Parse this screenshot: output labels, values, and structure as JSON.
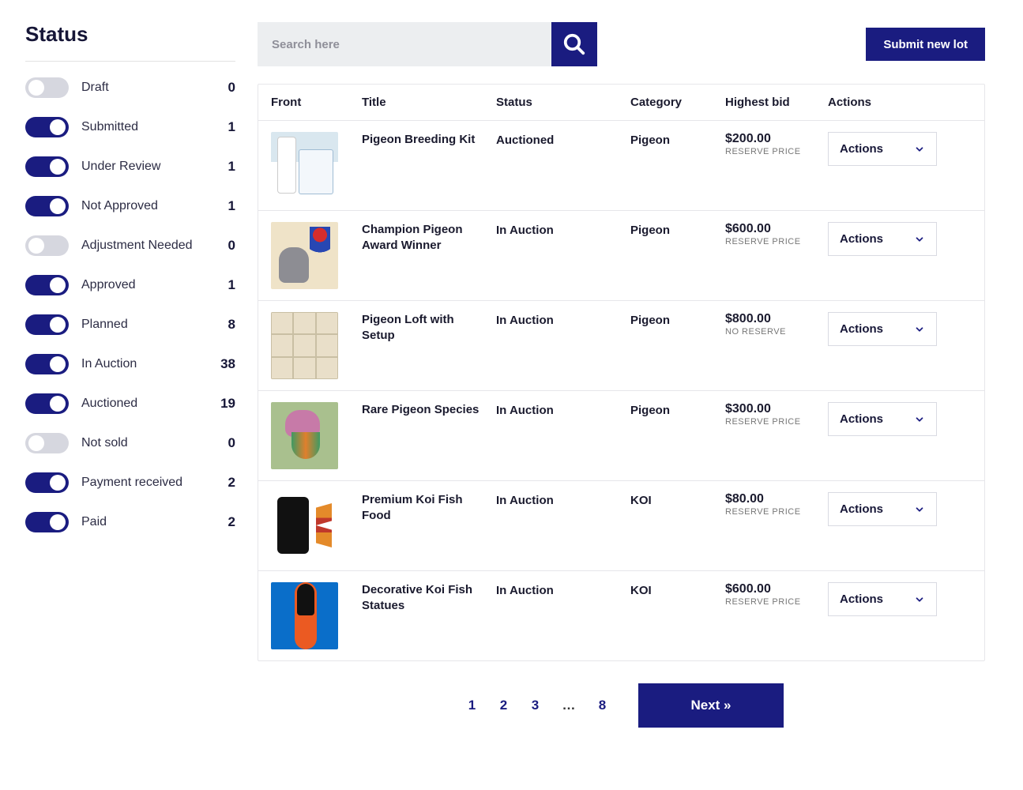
{
  "sidebar": {
    "title": "Status",
    "filters": [
      {
        "label": "Draft",
        "count": 0,
        "on": false
      },
      {
        "label": "Submitted",
        "count": 1,
        "on": true
      },
      {
        "label": "Under Review",
        "count": 1,
        "on": true
      },
      {
        "label": "Not Approved",
        "count": 1,
        "on": true
      },
      {
        "label": "Adjustment Needed",
        "count": 0,
        "on": false
      },
      {
        "label": "Approved",
        "count": 1,
        "on": true
      },
      {
        "label": "Planned",
        "count": 8,
        "on": true
      },
      {
        "label": "In Auction",
        "count": 38,
        "on": true
      },
      {
        "label": "Auctioned",
        "count": 19,
        "on": true
      },
      {
        "label": "Not sold",
        "count": 0,
        "on": false
      },
      {
        "label": "Payment received",
        "count": 2,
        "on": true
      },
      {
        "label": "Paid",
        "count": 2,
        "on": true
      }
    ]
  },
  "topbar": {
    "search_placeholder": "Search here",
    "search_value": "",
    "submit_label": "Submit new lot"
  },
  "table": {
    "headers": {
      "front": "Front",
      "title": "Title",
      "status": "Status",
      "category": "Category",
      "highest_bid": "Highest bid",
      "actions": "Actions"
    },
    "actions_button_label": "Actions",
    "rows": [
      {
        "title": "Pigeon Breeding Kit",
        "status": "Auctioned",
        "category": "Pigeon",
        "bid": "$200.00",
        "reserve": "RESERVE PRICE",
        "thumb": "a"
      },
      {
        "title": "Champion Pigeon Award Winner",
        "status": "In Auction",
        "category": "Pigeon",
        "bid": "$600.00",
        "reserve": "RESERVE PRICE",
        "thumb": "b"
      },
      {
        "title": "Pigeon Loft with Setup",
        "status": "In Auction",
        "category": "Pigeon",
        "bid": "$800.00",
        "reserve": "NO RESERVE",
        "thumb": "c"
      },
      {
        "title": "Rare Pigeon Species",
        "status": "In Auction",
        "category": "Pigeon",
        "bid": "$300.00",
        "reserve": "RESERVE PRICE",
        "thumb": "d"
      },
      {
        "title": "Premium Koi Fish Food",
        "status": "In Auction",
        "category": "KOI",
        "bid": "$80.00",
        "reserve": "RESERVE PRICE",
        "thumb": "e"
      },
      {
        "title": "Decorative Koi Fish Statues",
        "status": "In Auction",
        "category": "KOI",
        "bid": "$600.00",
        "reserve": "RESERVE PRICE",
        "thumb": "f"
      }
    ]
  },
  "pager": {
    "pages": [
      "1",
      "2",
      "3",
      "…",
      "8"
    ],
    "next_label": "Next »"
  }
}
